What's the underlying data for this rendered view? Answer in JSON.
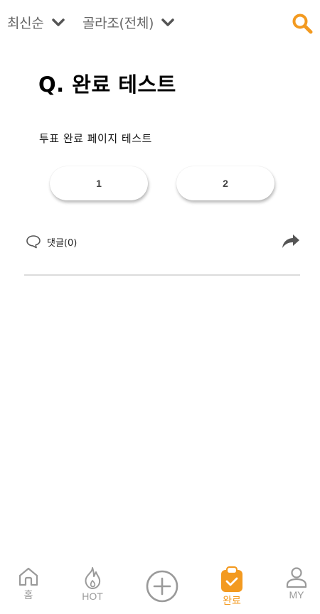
{
  "header": {
    "sort_label": "최신순",
    "group_label": "골라조(전체)",
    "icons": {
      "sort_chevron": "chevron-down-icon",
      "group_chevron": "chevron-down-icon",
      "search": "search-icon"
    },
    "accent_color": "#f39a20"
  },
  "question": {
    "title": "Q. 완료 테스트",
    "description": "투표 완료 페이지 테스트",
    "options": [
      "1",
      "2"
    ]
  },
  "comments": {
    "label": "댓글(0)",
    "icons": {
      "comment": "speech-bubble-icon",
      "share": "share-arrow-icon"
    }
  },
  "bottom_nav": {
    "items": [
      {
        "label": "홈",
        "icon": "home-icon",
        "active": false
      },
      {
        "label": "HOT",
        "icon": "flame-icon",
        "active": false
      },
      {
        "label": "",
        "icon": "plus-circle-icon",
        "active": false
      },
      {
        "label": "완료",
        "icon": "clipboard-check-icon",
        "active": true
      },
      {
        "label": "MY",
        "icon": "user-icon",
        "active": false
      }
    ],
    "active_color": "#f39a20",
    "inactive_color": "#9a9a9a"
  }
}
